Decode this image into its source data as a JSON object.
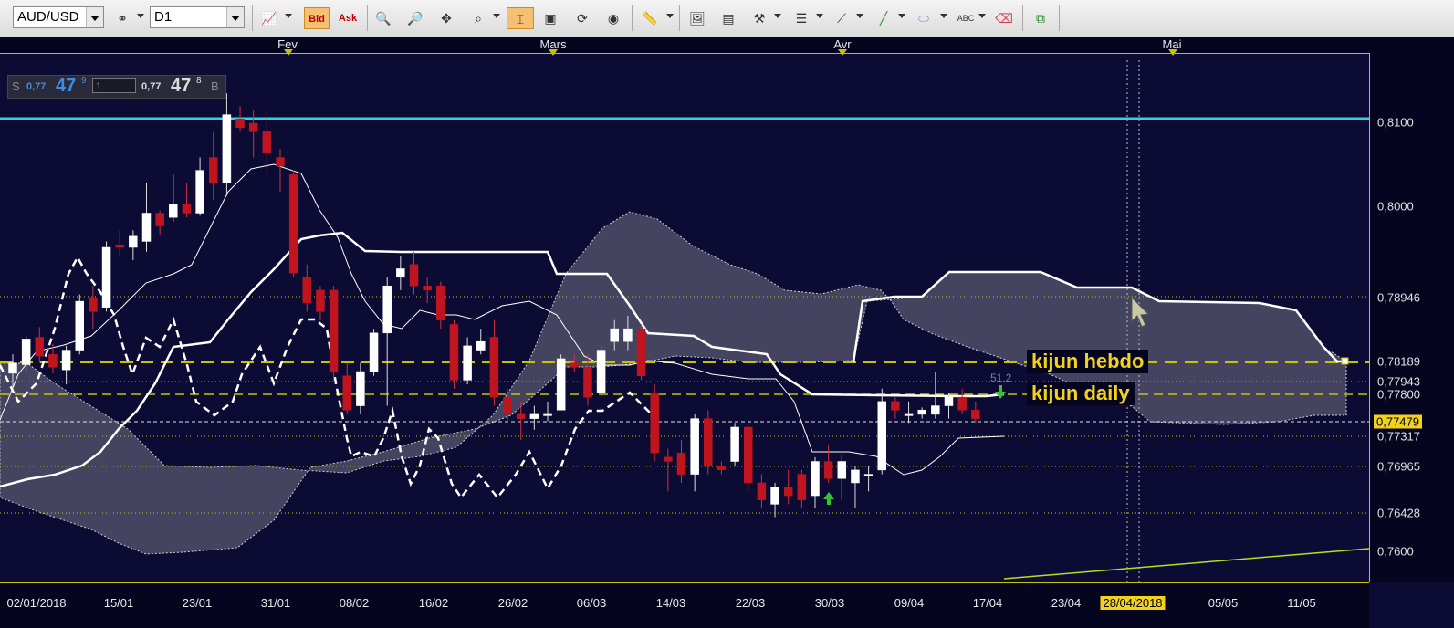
{
  "toolbar": {
    "symbol": "AUD/USD",
    "timeframe": "D1",
    "bid_label": "Bid",
    "ask_label": "Ask"
  },
  "quote": {
    "sell_label": "S",
    "bid_prefix": "0,77",
    "bid_big": "47",
    "bid_pip": "9",
    "quantity": "1",
    "ask_prefix": "0,77",
    "ask_big": "47",
    "ask_pip": "8",
    "buy_label": "B"
  },
  "months": [
    "Fev",
    "Mars",
    "Avr",
    "Mai"
  ],
  "price_labels": [
    "0,8100",
    "0,8000",
    "0,78946",
    "0,78189",
    "0,77943",
    "0,77800",
    "0,77317",
    "0,76965",
    "0,76428",
    "0,7600"
  ],
  "price_highlight": "0,77479",
  "dates": [
    "02/01/2018",
    "15/01",
    "23/01",
    "31/01",
    "08/02",
    "16/02",
    "26/02",
    "06/03",
    "14/03",
    "22/03",
    "30/03",
    "09/04",
    "17/04",
    "23/04",
    "28/04/2018",
    "05/05",
    "11/05"
  ],
  "annotations": {
    "kijun_hebdo": "kijun hebdo",
    "kijun_daily": "kijun daily",
    "fib_value": "51,2"
  },
  "colors": {
    "background": "#0b0b33",
    "bull": "#ffffff",
    "bear": "#c0141e",
    "cloud": "#4a4a66",
    "resistance": "#38d0e0",
    "annotation": "#f2d21a",
    "trendline": "#b4e020"
  },
  "chart_data": {
    "type": "candlestick",
    "symbol": "AUD/USD",
    "timeframe": "D1",
    "ylim": [
      0.757,
      0.8135
    ],
    "resistance_level": 0.8105,
    "kijun_hebdo": 0.78189,
    "kijun_daily": 0.778,
    "candles": [
      {
        "o": 0.7808,
        "h": 0.783,
        "l": 0.779,
        "c": 0.782
      },
      {
        "o": 0.7818,
        "h": 0.7852,
        "l": 0.7808,
        "c": 0.7848
      },
      {
        "o": 0.785,
        "h": 0.7862,
        "l": 0.782,
        "c": 0.7828
      },
      {
        "o": 0.783,
        "h": 0.7842,
        "l": 0.7808,
        "c": 0.7815
      },
      {
        "o": 0.7812,
        "h": 0.784,
        "l": 0.7795,
        "c": 0.7835
      },
      {
        "o": 0.7835,
        "h": 0.79,
        "l": 0.783,
        "c": 0.7892
      },
      {
        "o": 0.7895,
        "h": 0.791,
        "l": 0.786,
        "c": 0.788
      },
      {
        "o": 0.7885,
        "h": 0.7962,
        "l": 0.788,
        "c": 0.7955
      },
      {
        "o": 0.7958,
        "h": 0.7975,
        "l": 0.7945,
        "c": 0.7955
      },
      {
        "o": 0.7955,
        "h": 0.7975,
        "l": 0.794,
        "c": 0.7968
      },
      {
        "o": 0.7962,
        "h": 0.803,
        "l": 0.795,
        "c": 0.7995
      },
      {
        "o": 0.7995,
        "h": 0.7998,
        "l": 0.797,
        "c": 0.798
      },
      {
        "o": 0.799,
        "h": 0.804,
        "l": 0.7985,
        "c": 0.8005
      },
      {
        "o": 0.8005,
        "h": 0.803,
        "l": 0.799,
        "c": 0.7995
      },
      {
        "o": 0.7995,
        "h": 0.806,
        "l": 0.7992,
        "c": 0.8045
      },
      {
        "o": 0.806,
        "h": 0.809,
        "l": 0.801,
        "c": 0.803
      },
      {
        "o": 0.803,
        "h": 0.8135,
        "l": 0.8015,
        "c": 0.811
      },
      {
        "o": 0.8105,
        "h": 0.812,
        "l": 0.809,
        "c": 0.8095
      },
      {
        "o": 0.81,
        "h": 0.8115,
        "l": 0.806,
        "c": 0.809
      },
      {
        "o": 0.809,
        "h": 0.8115,
        "l": 0.804,
        "c": 0.8065
      },
      {
        "o": 0.806,
        "h": 0.807,
        "l": 0.802,
        "c": 0.805
      },
      {
        "o": 0.804,
        "h": 0.8045,
        "l": 0.792,
        "c": 0.7925
      },
      {
        "o": 0.792,
        "h": 0.7935,
        "l": 0.788,
        "c": 0.789
      },
      {
        "o": 0.7905,
        "h": 0.791,
        "l": 0.787,
        "c": 0.788
      },
      {
        "o": 0.7905,
        "h": 0.791,
        "l": 0.78,
        "c": 0.781
      },
      {
        "o": 0.7805,
        "h": 0.782,
        "l": 0.776,
        "c": 0.7765
      },
      {
        "o": 0.777,
        "h": 0.782,
        "l": 0.776,
        "c": 0.781
      },
      {
        "o": 0.781,
        "h": 0.786,
        "l": 0.7805,
        "c": 0.7855
      },
      {
        "o": 0.7855,
        "h": 0.792,
        "l": 0.777,
        "c": 0.791
      },
      {
        "o": 0.792,
        "h": 0.7945,
        "l": 0.7905,
        "c": 0.793
      },
      {
        "o": 0.7935,
        "h": 0.795,
        "l": 0.79,
        "c": 0.791
      },
      {
        "o": 0.791,
        "h": 0.792,
        "l": 0.789,
        "c": 0.7905
      },
      {
        "o": 0.791,
        "h": 0.7915,
        "l": 0.786,
        "c": 0.787
      },
      {
        "o": 0.7865,
        "h": 0.787,
        "l": 0.779,
        "c": 0.78
      },
      {
        "o": 0.78,
        "h": 0.785,
        "l": 0.7795,
        "c": 0.784
      },
      {
        "o": 0.7835,
        "h": 0.786,
        "l": 0.783,
        "c": 0.7845
      },
      {
        "o": 0.785,
        "h": 0.787,
        "l": 0.777,
        "c": 0.778
      },
      {
        "o": 0.778,
        "h": 0.779,
        "l": 0.775,
        "c": 0.776
      },
      {
        "o": 0.776,
        "h": 0.7775,
        "l": 0.773,
        "c": 0.7755
      },
      {
        "o": 0.7755,
        "h": 0.777,
        "l": 0.7742,
        "c": 0.776
      },
      {
        "o": 0.776,
        "h": 0.7775,
        "l": 0.7752,
        "c": 0.776
      },
      {
        "o": 0.7765,
        "h": 0.783,
        "l": 0.7765,
        "c": 0.7825
      },
      {
        "o": 0.782,
        "h": 0.783,
        "l": 0.781,
        "c": 0.7815
      },
      {
        "o": 0.7815,
        "h": 0.783,
        "l": 0.777,
        "c": 0.778
      },
      {
        "o": 0.7785,
        "h": 0.784,
        "l": 0.778,
        "c": 0.7835
      },
      {
        "o": 0.7845,
        "h": 0.787,
        "l": 0.7835,
        "c": 0.786
      },
      {
        "o": 0.7845,
        "h": 0.7875,
        "l": 0.7835,
        "c": 0.786
      },
      {
        "o": 0.786,
        "h": 0.7865,
        "l": 0.78,
        "c": 0.7805
      },
      {
        "o": 0.7785,
        "h": 0.7795,
        "l": 0.7705,
        "c": 0.7715
      },
      {
        "o": 0.771,
        "h": 0.772,
        "l": 0.767,
        "c": 0.7705
      },
      {
        "o": 0.7715,
        "h": 0.773,
        "l": 0.768,
        "c": 0.769
      },
      {
        "o": 0.769,
        "h": 0.776,
        "l": 0.767,
        "c": 0.7755
      },
      {
        "o": 0.7755,
        "h": 0.7765,
        "l": 0.769,
        "c": 0.77
      },
      {
        "o": 0.77,
        "h": 0.7705,
        "l": 0.769,
        "c": 0.7695
      },
      {
        "o": 0.7705,
        "h": 0.775,
        "l": 0.77,
        "c": 0.7745
      },
      {
        "o": 0.7745,
        "h": 0.775,
        "l": 0.767,
        "c": 0.768
      },
      {
        "o": 0.768,
        "h": 0.769,
        "l": 0.765,
        "c": 0.766
      },
      {
        "o": 0.7655,
        "h": 0.768,
        "l": 0.764,
        "c": 0.7675
      },
      {
        "o": 0.7675,
        "h": 0.7695,
        "l": 0.7655,
        "c": 0.7665
      },
      {
        "o": 0.769,
        "h": 0.7695,
        "l": 0.765,
        "c": 0.766
      },
      {
        "o": 0.7665,
        "h": 0.771,
        "l": 0.765,
        "c": 0.7705
      },
      {
        "o": 0.7705,
        "h": 0.7725,
        "l": 0.768,
        "c": 0.7685
      },
      {
        "o": 0.7685,
        "h": 0.7712,
        "l": 0.766,
        "c": 0.7705
      },
      {
        "o": 0.768,
        "h": 0.77,
        "l": 0.765,
        "c": 0.7695
      },
      {
        "o": 0.769,
        "h": 0.77,
        "l": 0.767,
        "c": 0.769
      },
      {
        "o": 0.7695,
        "h": 0.779,
        "l": 0.769,
        "c": 0.7775
      },
      {
        "o": 0.7775,
        "h": 0.778,
        "l": 0.7755,
        "c": 0.7765
      },
      {
        "o": 0.776,
        "h": 0.7775,
        "l": 0.775,
        "c": 0.776
      },
      {
        "o": 0.776,
        "h": 0.7768,
        "l": 0.7755,
        "c": 0.7765
      },
      {
        "o": 0.776,
        "h": 0.781,
        "l": 0.7755,
        "c": 0.777
      },
      {
        "o": 0.777,
        "h": 0.7785,
        "l": 0.7755,
        "c": 0.778
      },
      {
        "o": 0.778,
        "h": 0.779,
        "l": 0.776,
        "c": 0.7765
      },
      {
        "o": 0.7765,
        "h": 0.7775,
        "l": 0.775,
        "c": 0.7755
      }
    ]
  }
}
